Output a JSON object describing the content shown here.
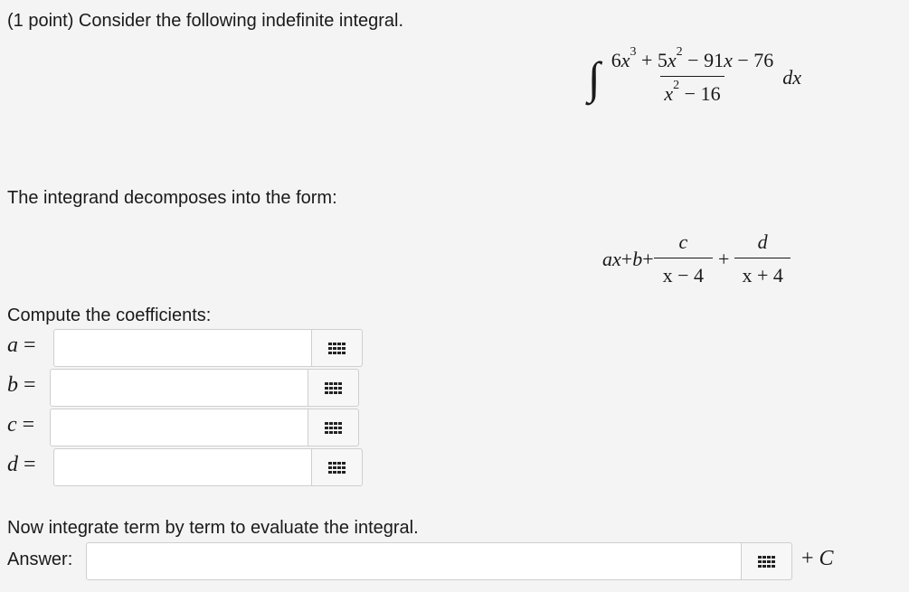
{
  "problem": {
    "intro": "(1 point) Consider the following indefinite integral.",
    "decompose_text": "The integrand decomposes into the form:",
    "compute_text": "Compute the coefficients:",
    "integrate_text": "Now integrate term by term to evaluate the integral.",
    "answer_label": "Answer:"
  },
  "integral": {
    "sign": "∫",
    "numerator": {
      "c1": "6",
      "x1": "x",
      "e1": "3",
      "t2": " + 5",
      "x2": "x",
      "e2": "2",
      "t3": " − 91",
      "x3": "x",
      "t4": " − 76"
    },
    "denominator": {
      "x": "x",
      "e": "2",
      "rest": " − 16"
    },
    "dx": "dx"
  },
  "decomposition": {
    "a": "a",
    "x": "x",
    "plus1": " + ",
    "b": "b",
    "plus2": " + ",
    "c": "c",
    "den1": "x − 4",
    "plus3": "+",
    "d": "d",
    "den2": "x + 4"
  },
  "coefficients": [
    {
      "label": "a",
      "eq": " =",
      "value": ""
    },
    {
      "label": "b",
      "eq": " =",
      "value": ""
    },
    {
      "label": "c",
      "eq": " =",
      "value": ""
    },
    {
      "label": "d",
      "eq": " =",
      "value": ""
    }
  ],
  "answer": {
    "value": "",
    "constant": "+ C"
  },
  "icons": {
    "matrix_button": "grid-icon"
  }
}
